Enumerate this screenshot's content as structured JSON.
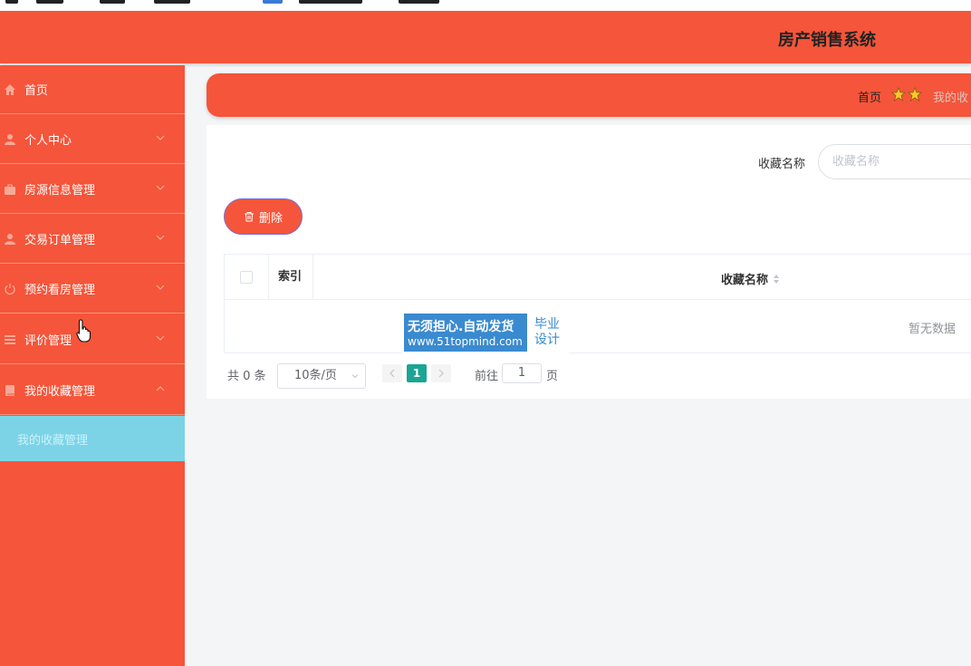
{
  "header": {
    "title": "房产销售系统"
  },
  "sidebar": {
    "items": [
      {
        "label": "首页",
        "icon": "home-icon"
      },
      {
        "label": "个人中心",
        "icon": "user-icon"
      },
      {
        "label": "房源信息管理",
        "icon": "briefcase-icon"
      },
      {
        "label": "交易订单管理",
        "icon": "user-icon"
      },
      {
        "label": "预约看房管理",
        "icon": "power-icon"
      },
      {
        "label": "评价管理",
        "icon": "list-icon"
      },
      {
        "label": "我的收藏管理",
        "icon": "book-icon"
      }
    ],
    "submenu_active": "我的收藏管理"
  },
  "breadcrumb": {
    "home": "首页",
    "current": "我的收"
  },
  "search": {
    "label": "收藏名称",
    "placeholder": "收藏名称"
  },
  "toolbar": {
    "delete_label": "删除"
  },
  "table": {
    "columns": {
      "index": "索引",
      "name": "收藏名称"
    },
    "empty_text": "暂无数据"
  },
  "pagination": {
    "total_text": "共 0 条",
    "page_size": "10条/页",
    "current_page": "1",
    "goto_label": "前往",
    "goto_value": "1",
    "page_suffix": "页"
  },
  "watermark": {
    "line1": "无须担心.自动发货",
    "line2": "www.51topmind.com",
    "right1": "毕业",
    "right2": "设计"
  },
  "colors": {
    "primary": "#f5553a",
    "submenu": "#7dd3e6",
    "pager_active": "#1aa594"
  }
}
